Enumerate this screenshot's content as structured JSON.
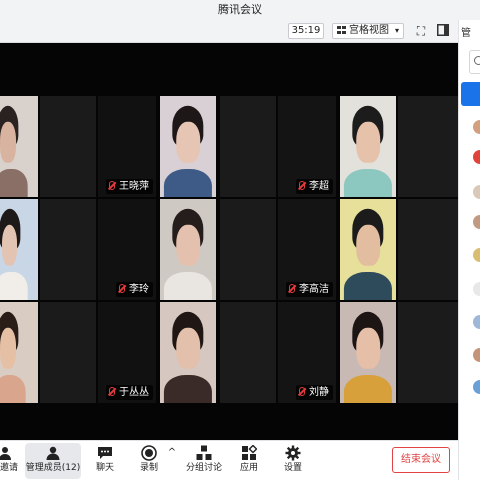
{
  "window": {
    "title": "腾讯会议"
  },
  "topbar": {
    "timer": "35:19",
    "view_label": "宫格视图"
  },
  "sidepanel": {
    "top_text": "管"
  },
  "participants": [
    {
      "name": "王晓萍"
    },
    {
      "name": "李超"
    },
    {
      "name": "李玲"
    },
    {
      "name": "李高洁"
    },
    {
      "name": "于丛丛"
    },
    {
      "name": "刘静"
    }
  ],
  "toolbar": {
    "invite_label": "邀请",
    "members_label": "管理成员(12)",
    "chat_label": "聊天",
    "record_label": "录制",
    "breakout_label": "分组讨论",
    "apps_label": "应用",
    "settings_label": "设置",
    "end_label": "结束会议"
  },
  "colors": {
    "end_button": "#e04444",
    "primary": "#1a73e8",
    "muted_mic": "#e23b3b"
  }
}
